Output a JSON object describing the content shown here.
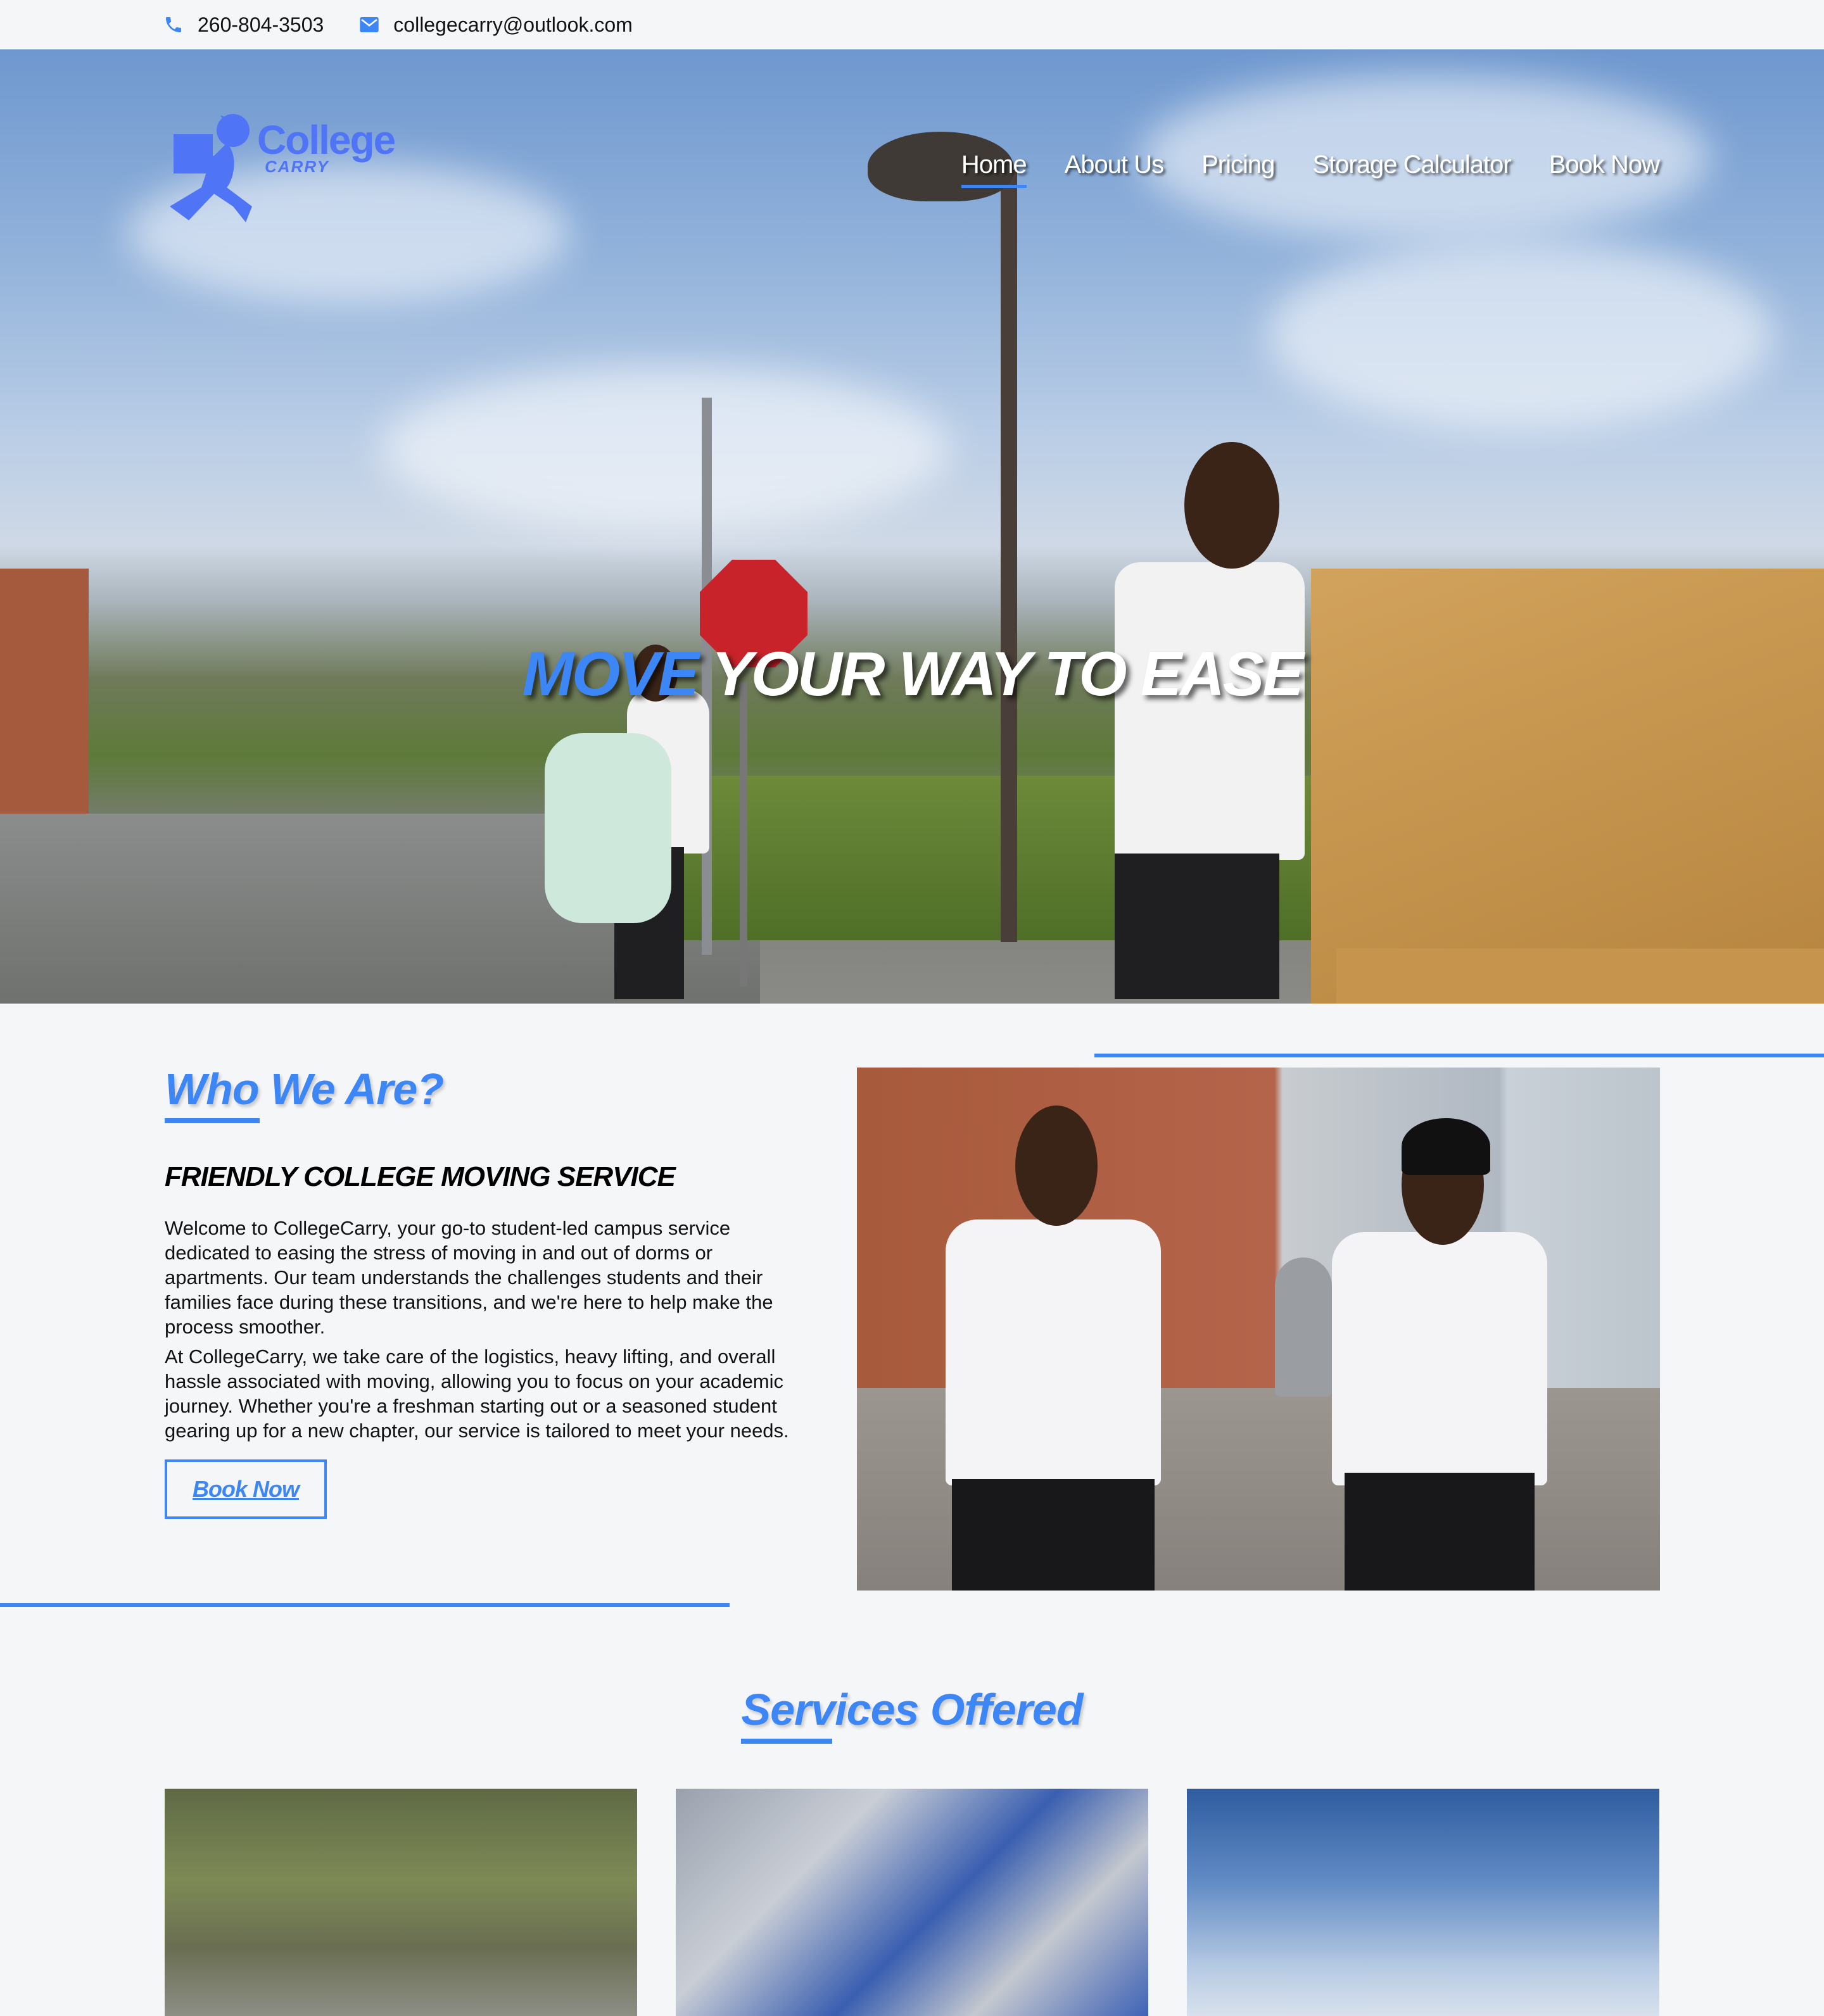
{
  "topbar": {
    "phone_icon": "phone-icon",
    "phone": "260-804-3503",
    "email_icon": "envelope-icon",
    "email": "collegecarry@outlook.com"
  },
  "brand": {
    "logo_icon": "running-mover-with-box-logo",
    "name_line1": "College",
    "name_line2": "CARRY",
    "color": "#4f74f5"
  },
  "nav": {
    "items": [
      {
        "label": "Home",
        "active": true
      },
      {
        "label": "About Us",
        "active": false
      },
      {
        "label": "Pricing",
        "active": false
      },
      {
        "label": "Storage Calculator",
        "active": false
      },
      {
        "label": "Book Now",
        "active": false
      }
    ]
  },
  "hero": {
    "title_accent": "MOVE",
    "title_rest": " YOUR WAY TO EASE",
    "image_alt": "Two movers carrying boxes and bags on campus street"
  },
  "who": {
    "heading": "Who We Are?",
    "subheading": "FRIENDLY COLLEGE MOVING SERVICE",
    "paragraphs": [
      "Welcome to CollegeCarry, your go-to student-led campus service dedicated to easing the stress of moving in and out of dorms or apartments. Our team understands the challenges students and their families face during these transitions, and we're here to help make the process smoother.",
      "At CollegeCarry, we take care of the logistics, heavy lifting, and overall hassle associated with moving, allowing you to focus on your academic journey. Whether you're a freshman starting out or a seasoned student gearing up for a new chapter, our service is tailored to meet your needs."
    ],
    "button": "Book Now",
    "image_alt": "Two CollegeCarry team members walking in front of campus buildings"
  },
  "services": {
    "heading": "Services Offered",
    "cards": [
      {
        "image_alt": "Movers carrying furniture under trees"
      },
      {
        "image_alt": "Storage units with blue roll-up doors"
      },
      {
        "image_alt": "Mover on campus under blue sky"
      }
    ]
  },
  "colors": {
    "accent": "#3d86f5",
    "background": "#f5f6f8",
    "text": "#111111"
  }
}
